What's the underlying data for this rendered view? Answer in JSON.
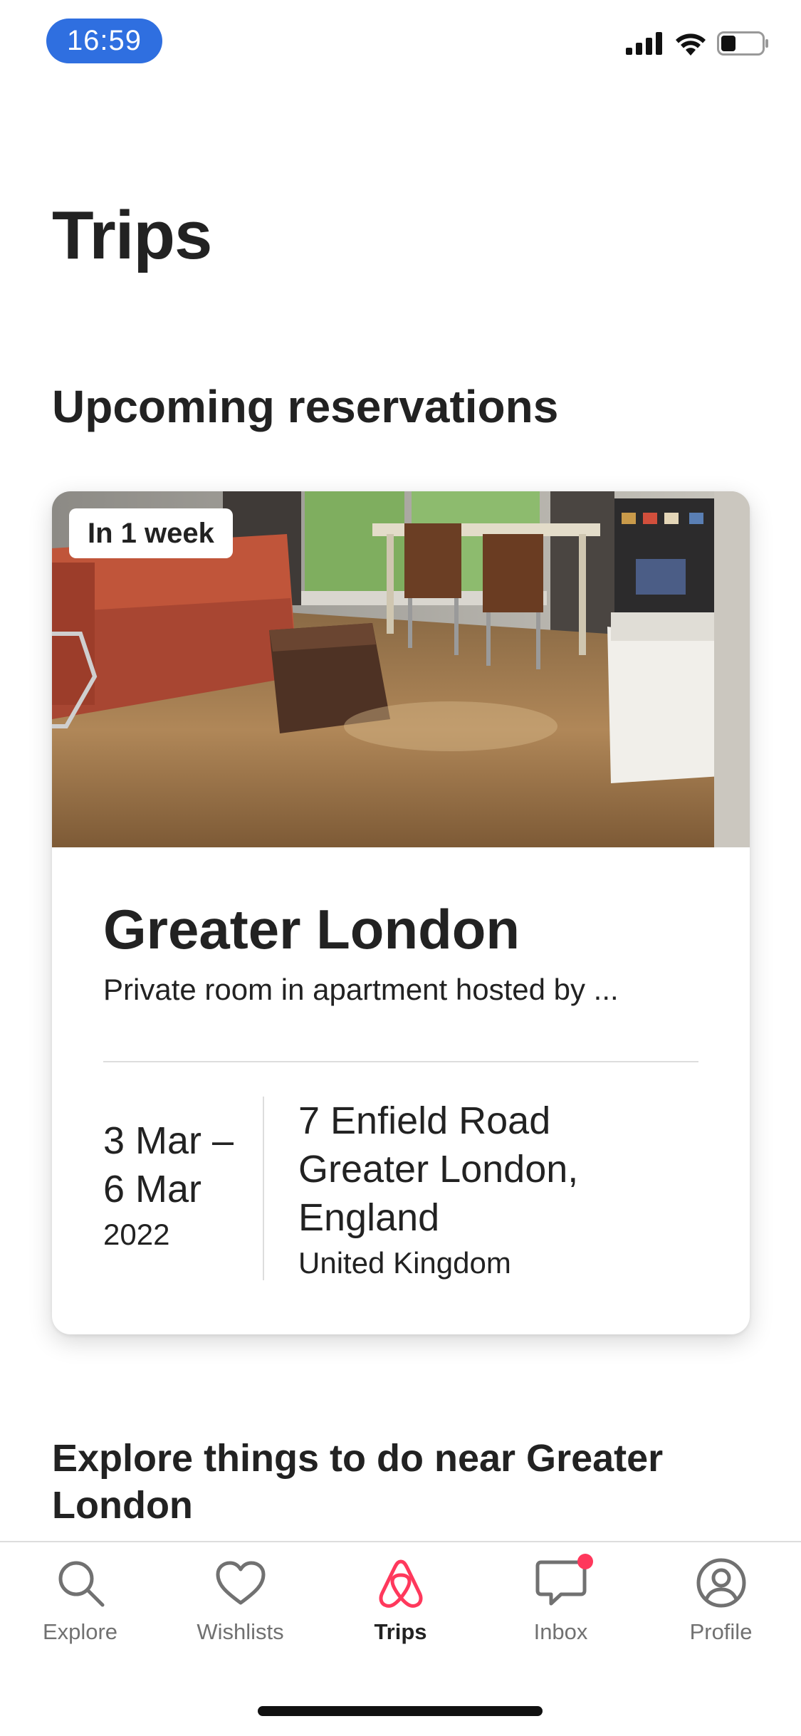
{
  "status_bar": {
    "time": "16:59"
  },
  "page": {
    "title": "Trips",
    "section_title": "Upcoming reservations"
  },
  "reservation": {
    "badge": "In 1 week",
    "title": "Greater London",
    "subtitle": "Private room in apartment hosted by ...",
    "date_line_1": "3 Mar –",
    "date_line_2": "6 Mar",
    "year": "2022",
    "address_line_1": "7 Enfield Road",
    "address_line_2": "Greater London,",
    "address_line_3": "England",
    "country": "United Kingdom"
  },
  "explore": {
    "title": "Explore things to do near Greater London"
  },
  "tabbar": {
    "items": [
      {
        "label": "Explore",
        "icon": "search-icon",
        "active": false
      },
      {
        "label": "Wishlists",
        "icon": "heart-icon",
        "active": false
      },
      {
        "label": "Trips",
        "icon": "airbnb-logo-icon",
        "active": true
      },
      {
        "label": "Inbox",
        "icon": "message-icon",
        "active": false,
        "badge": true
      },
      {
        "label": "Profile",
        "icon": "user-circle-icon",
        "active": false
      }
    ]
  },
  "colors": {
    "accent": "#ff385c",
    "time_pill": "#2f6fe0",
    "text": "#222222",
    "muted": "#717171"
  }
}
